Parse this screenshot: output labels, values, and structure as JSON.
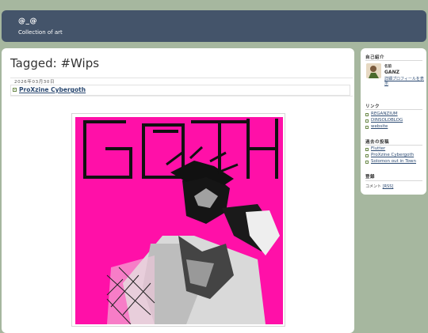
{
  "header": {
    "title": "@_@",
    "description": "Collection of art"
  },
  "main": {
    "tag_title": "Tagged: #Wips",
    "post": {
      "date": "2026年03月30日",
      "title": "ProXzine Cybergoth"
    },
    "artwork": {
      "text": "GOTH",
      "background": "#ff00aa"
    }
  },
  "sidebar": {
    "profile": {
      "heading": "自己紹介",
      "name_label": "名前",
      "name": "GANZ",
      "link": "詳細プロフィールを表示"
    },
    "links": {
      "heading": "リンク",
      "items": [
        "REGANZIUM",
        "DINSOLOBLOG",
        "website"
      ]
    },
    "recent": {
      "heading": "過去の投稿",
      "items": [
        "Flutter",
        "ProXzine Cybergoth",
        "Solomon out in Town"
      ]
    },
    "subscribe": {
      "heading": "登録",
      "comments_label": "コメント",
      "rss_label": "[RSS]"
    }
  },
  "colors": {
    "background": "#a6b79f",
    "header": "#44546a",
    "link": "#2c4a72"
  }
}
